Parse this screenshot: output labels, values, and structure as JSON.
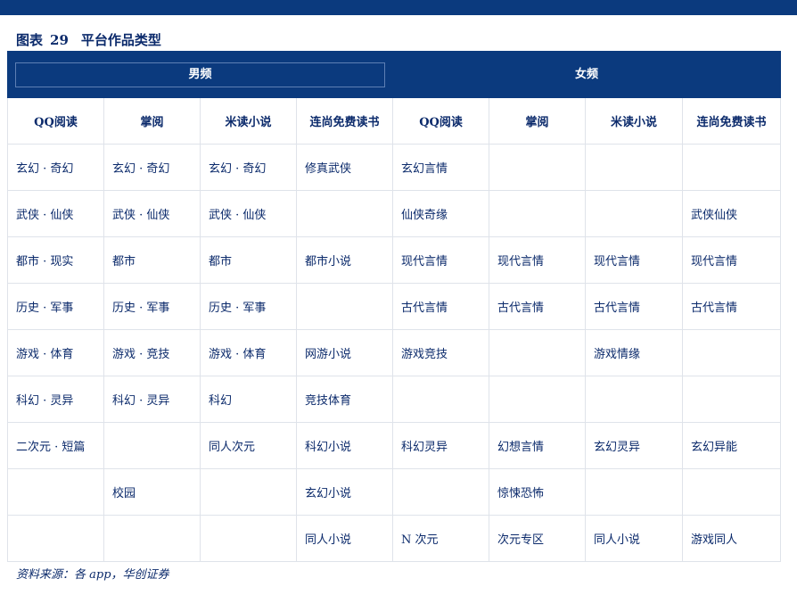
{
  "figure": {
    "label": "图表",
    "number": "29",
    "title": "平台作品类型"
  },
  "groups": {
    "male": "男频",
    "female": "女频"
  },
  "columns": [
    "QQ阅读",
    "掌阅",
    "米读小说",
    "连尚免费读书",
    "QQ阅读",
    "掌阅",
    "米读小说",
    "连尚免费读书"
  ],
  "rows": [
    [
      "玄幻 · 奇幻",
      "玄幻 · 奇幻",
      "玄幻 · 奇幻",
      "修真武侠",
      "玄幻言情",
      "",
      "",
      ""
    ],
    [
      "武侠 · 仙侠",
      "武侠 · 仙侠",
      "武侠 · 仙侠",
      "",
      "仙侠奇缘",
      "",
      "",
      "武侠仙侠"
    ],
    [
      "都市 · 现实",
      "都市",
      "都市",
      "都市小说",
      "现代言情",
      "现代言情",
      "现代言情",
      "现代言情"
    ],
    [
      "历史 · 军事",
      "历史 · 军事",
      "历史 · 军事",
      "",
      "古代言情",
      "古代言情",
      "古代言情",
      "古代言情"
    ],
    [
      "游戏 · 体育",
      "游戏 · 竞技",
      "游戏 · 体育",
      "网游小说",
      "游戏竞技",
      "",
      "游戏情缘",
      ""
    ],
    [
      "科幻 · 灵异",
      "科幻 · 灵异",
      "科幻",
      "竞技体育",
      "",
      "",
      "",
      ""
    ],
    [
      "二次元 · 短篇",
      "",
      "同人次元",
      "科幻小说",
      "科幻灵异",
      "幻想言情",
      "玄幻灵异",
      "玄幻异能"
    ],
    [
      "",
      "校园",
      "",
      "玄幻小说",
      "",
      "惊悚恐怖",
      "",
      ""
    ],
    [
      "",
      "",
      "",
      "同人小说",
      "N 次元",
      "次元专区",
      "同人小说",
      "游戏同人"
    ]
  ],
  "source": "资料来源：各 app，华创证券"
}
